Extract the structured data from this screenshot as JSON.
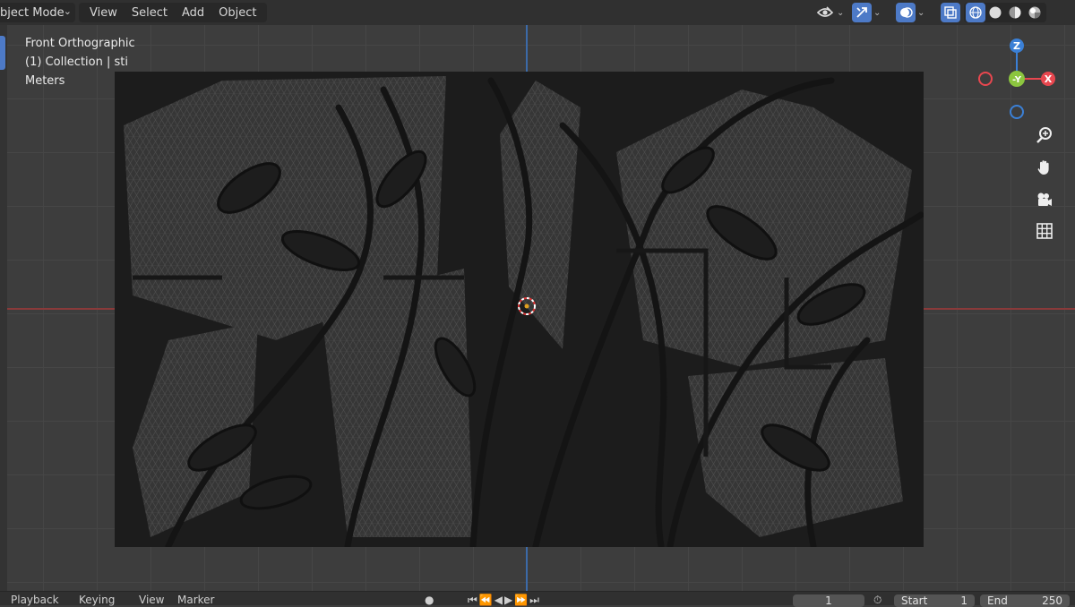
{
  "header": {
    "mode_label": "bject Mode",
    "menu": [
      "View",
      "Select",
      "Add",
      "Object"
    ]
  },
  "overlay": {
    "view_name": "Front Orthographic",
    "collection": "(1) Collection | sti",
    "units": "Meters"
  },
  "gizmo": {
    "z": "Z",
    "x": "X",
    "y": "-Y"
  },
  "timeline": {
    "playback": "Playback",
    "keying": "Keying",
    "view": "View",
    "marker": "Marker",
    "current_frame": "1",
    "start_label": "Start",
    "start_value": "1",
    "end_label": "End",
    "end_value": "250"
  },
  "colors": {
    "x_axis": "#e8474f",
    "y_axis": "#8cc63f",
    "z_axis": "#3b80d6",
    "accent": "#4d7ac7"
  }
}
